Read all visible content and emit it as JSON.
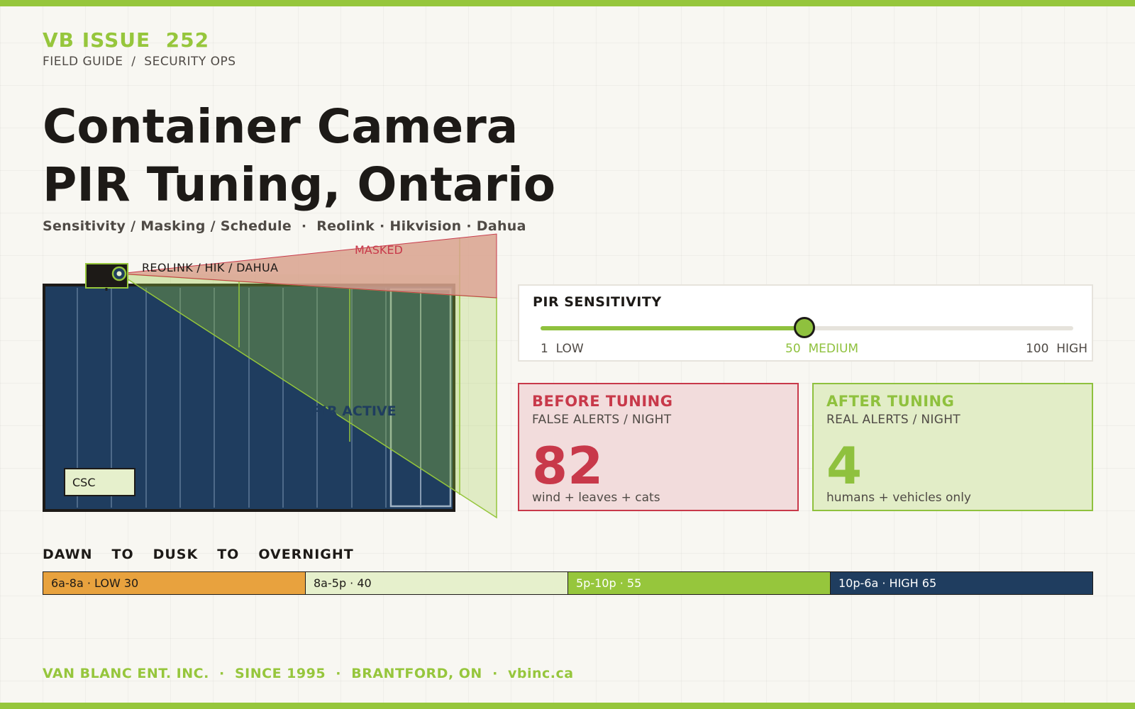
{
  "masthead": {
    "issue": "VB ISSUE  252",
    "kicker": "FIELD GUIDE  /  SECURITY OPS"
  },
  "headline": {
    "line1": "Container Camera",
    "line2": "PIR Tuning, Ontario",
    "subtitle": "Sensitivity / Masking / Schedule  ·  Reolink · Hikvision · Dahua"
  },
  "diagram": {
    "camera_label": "REOLINK / HIK / DAHUA",
    "masked_label": "MASKED",
    "active_label": "PIR ACTIVE",
    "container_label": "CSC",
    "colors": {
      "container": "#1f3d5f",
      "mask": "#d9ad9a",
      "active": "#96c63c"
    }
  },
  "pir": {
    "title": "PIR SENSITIVITY",
    "value": 50,
    "min": 1,
    "max": 100,
    "low_label": "1  LOW",
    "mid_label": "50  MEDIUM",
    "high_label": "100  HIGH"
  },
  "before": {
    "title": "BEFORE TUNING",
    "subtitle": "FALSE ALERTS / NIGHT",
    "value": "82",
    "note": "wind + leaves + cats",
    "color": "#c8394a"
  },
  "after": {
    "title": "AFTER TUNING",
    "subtitle": "REAL ALERTS / NIGHT",
    "value": "4",
    "note": "humans + vehicles only",
    "color": "#8fc13e"
  },
  "schedule": {
    "title_words": [
      "DAWN",
      "TO",
      "DUSK",
      "TO",
      "OVERNIGHT"
    ],
    "segments": [
      {
        "label": "6a-8a · LOW 30",
        "bg": "#e8a23e",
        "fg": "#1d1a17"
      },
      {
        "label": "8a-5p · 40",
        "bg": "#e6f0cc",
        "fg": "#1d1a17"
      },
      {
        "label": "5p-10p · 55",
        "bg": "#96c63c",
        "fg": "#ffffff"
      },
      {
        "label": "10p-6a · HIGH 65",
        "bg": "#1f3d5f",
        "fg": "#ffffff"
      }
    ]
  },
  "footer": {
    "text": "VAN BLANC ENT. INC.  ·  SINCE 1995  ·  BRANTFORD, ON  ·  vbinc.ca"
  },
  "colors": {
    "accent": "#96c63c",
    "alert": "#c8394a",
    "navy": "#1f3d5f",
    "ink": "#1d1a17",
    "background": "#f8f7f2"
  }
}
